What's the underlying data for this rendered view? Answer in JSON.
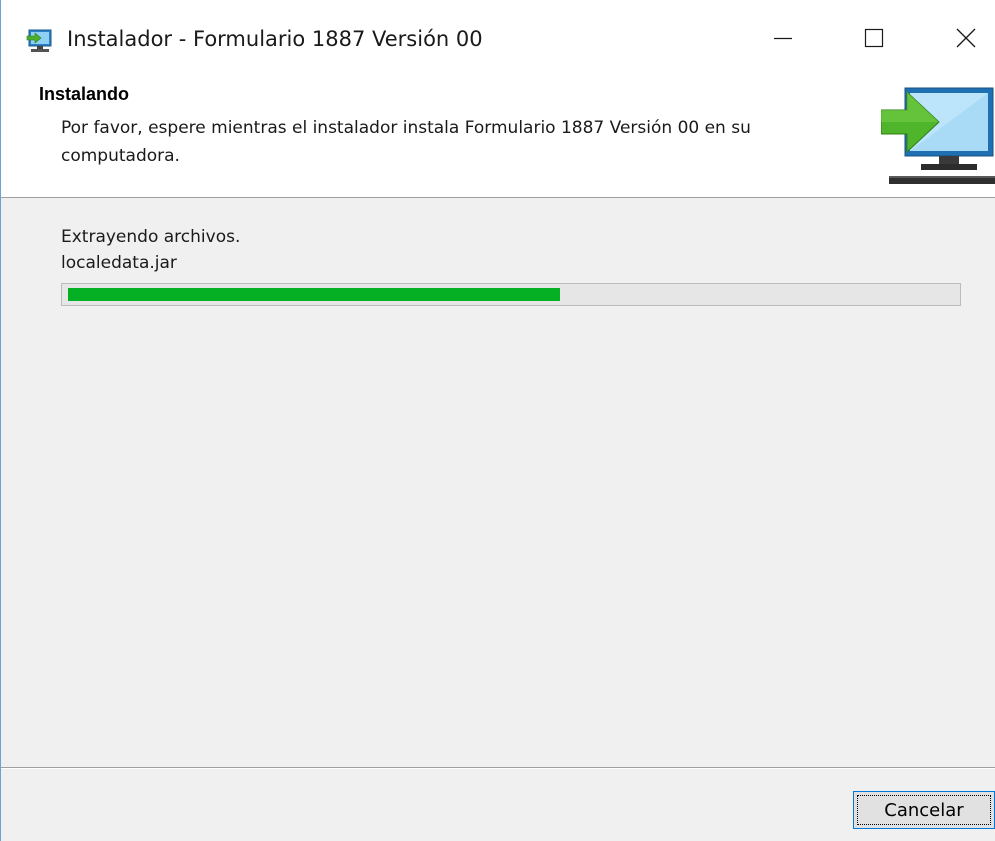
{
  "window": {
    "title": "Instalador - Formulario 1887 Versión 00",
    "app_icon": "installer-icon",
    "controls": {
      "minimize_icon": "minimize-icon",
      "maximize_icon": "maximize-icon",
      "close_icon": "close-icon"
    }
  },
  "header": {
    "title": "Instalando",
    "description": "Por favor, espere mientras el instalador instala Formulario 1887 Versión 00 en su computadora.",
    "logo_icon": "computer-install-icon"
  },
  "progress": {
    "status": "Extrayendo archivos.",
    "current_file": "localedata.jar",
    "value": 0.555,
    "color": "#06b025"
  },
  "footer": {
    "cancel_label": "Cancelar"
  }
}
